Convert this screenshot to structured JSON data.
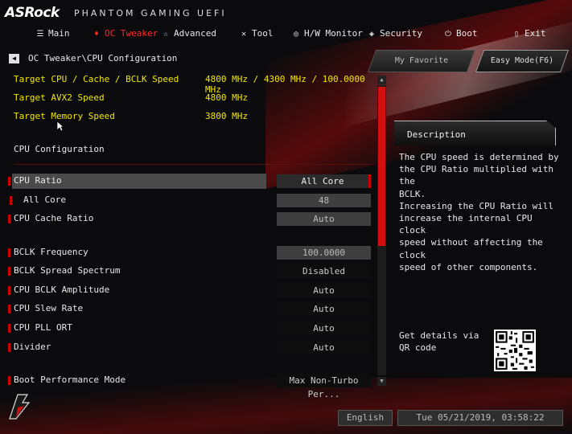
{
  "brand": {
    "logo": "ASRock",
    "subtitle": "PHANTOM GAMING UEFI"
  },
  "nav": [
    {
      "label": "Main",
      "icon": "list-icon"
    },
    {
      "label": "OC Tweaker",
      "icon": "flame-icon",
      "active": true
    },
    {
      "label": "Advanced",
      "icon": "star-icon"
    },
    {
      "label": "Tool",
      "icon": "tools-icon"
    },
    {
      "label": "H/W Monitor",
      "icon": "globe-icon"
    },
    {
      "label": "Security",
      "icon": "shield-icon"
    },
    {
      "label": "Boot",
      "icon": "power-icon"
    },
    {
      "label": "Exit",
      "icon": "exit-icon"
    }
  ],
  "breadcrumb": "OC Tweaker\\CPU Configuration",
  "buttons": {
    "favorite": "My Favorite",
    "easy_mode": "Easy Mode(F6)"
  },
  "info": [
    {
      "label": "Target CPU / Cache / BCLK Speed",
      "value": "4800 MHz / 4300 MHz / 100.0000 MHz"
    },
    {
      "label": "Target AVX2 Speed",
      "value": "4800 MHz"
    },
    {
      "label": "Target Memory Speed",
      "value": "3800 MHz"
    }
  ],
  "section_title": "CPU Configuration",
  "settings": [
    {
      "label": "CPU Ratio",
      "value": "All Core"
    },
    {
      "label": "All Core",
      "value": "48"
    },
    {
      "label": "CPU Cache Ratio",
      "value": "Auto"
    },
    {
      "label": "BCLK Frequency",
      "value": "100.0000"
    },
    {
      "label": "BCLK Spread Spectrum",
      "value": "Disabled"
    },
    {
      "label": "CPU BCLK Amplitude",
      "value": "Auto"
    },
    {
      "label": "CPU Slew Rate",
      "value": "Auto"
    },
    {
      "label": "CPU PLL ORT",
      "value": "Auto"
    },
    {
      "label": "Divider",
      "value": "Auto"
    },
    {
      "label": "Boot Performance Mode",
      "value": "Max Non-Turbo Per..."
    }
  ],
  "description": {
    "title": "Description",
    "text": "The CPU speed is determined by\nthe CPU Ratio multiplied with the\nBCLK.\nIncreasing the CPU Ratio will\nincrease the internal CPU clock\nspeed without affecting the clock\nspeed of other components."
  },
  "qr_text": "Get details via QR code",
  "footer": {
    "language": "English",
    "datetime": "Tue 05/21/2019, 03:58:22"
  },
  "colors": {
    "accent": "#d10f0f",
    "info_text": "#f3e800",
    "active_tab": "#ff2a2a"
  }
}
